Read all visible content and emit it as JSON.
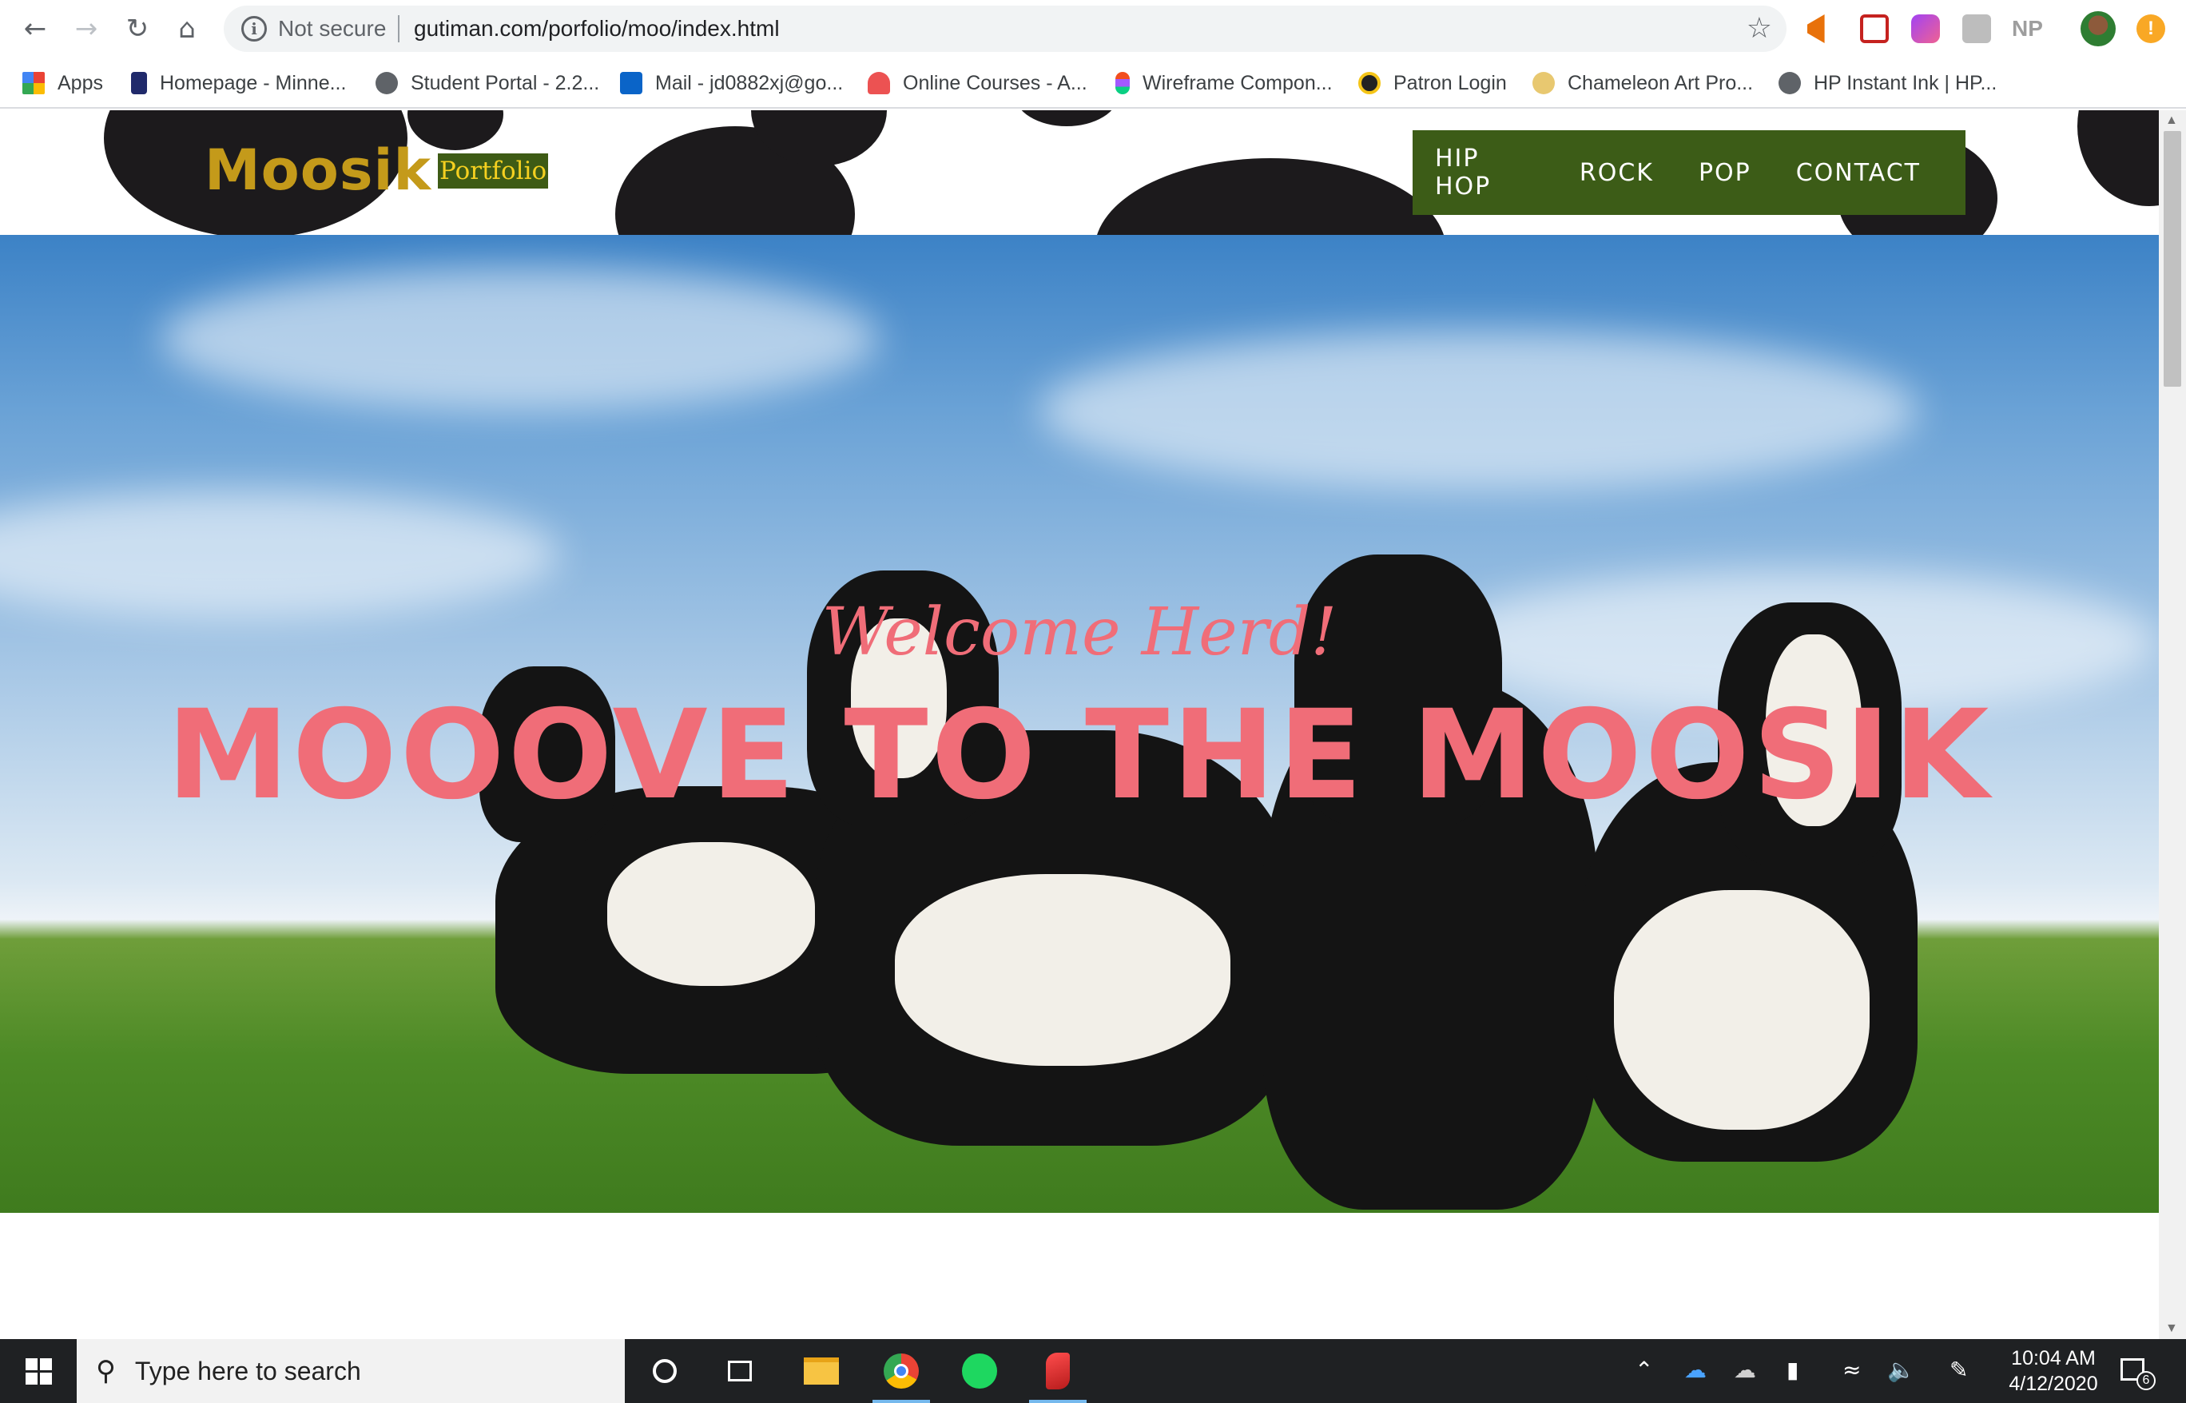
{
  "browser": {
    "security_label": "Not secure",
    "url": "gutiman.com/porfolio/moo/index.html",
    "profile_initials": "NP",
    "bookmarks": [
      {
        "label": "Apps",
        "icon": "apps-grid-icon",
        "color": "#e94235"
      },
      {
        "label": "Homepage - Minne...",
        "icon": "bookmark-icon",
        "color": "#202a6b"
      },
      {
        "label": "Student Portal - 2.2...",
        "icon": "globe-icon",
        "color": "#5f6368"
      },
      {
        "label": "Mail - jd0882xj@go...",
        "icon": "outlook-icon",
        "color": "#0a64c8"
      },
      {
        "label": "Online Courses - A...",
        "icon": "udemy-icon",
        "color": "#ec5252"
      },
      {
        "label": "Wireframe Compon...",
        "icon": "figma-icon",
        "color": "#f24e1e"
      },
      {
        "label": "Patron Login",
        "icon": "patron-icon",
        "color": "#222222"
      },
      {
        "label": "Chameleon Art Pro...",
        "icon": "chameleon-icon",
        "color": "#e8c870"
      },
      {
        "label": "HP Instant Ink | HP...",
        "icon": "globe-icon",
        "color": "#5f6368"
      }
    ]
  },
  "site": {
    "logo": "Moosik",
    "logo_tag": "Portfolio",
    "nav": [
      "HIP HOP",
      "ROCK",
      "POP",
      "CONTACT"
    ],
    "hero_subtitle": "Welcome Herd!",
    "hero_title": "MOOOVE TO THE MOOSIK",
    "colors": {
      "accent": "#f06d78",
      "nav_bg": "#3c5c17",
      "logo": "#c49a1a",
      "tag_text": "#f5d020"
    }
  },
  "taskbar": {
    "search_placeholder": "Type here to search",
    "time": "10:04 AM",
    "date": "4/12/2020",
    "notification_count": "6"
  }
}
